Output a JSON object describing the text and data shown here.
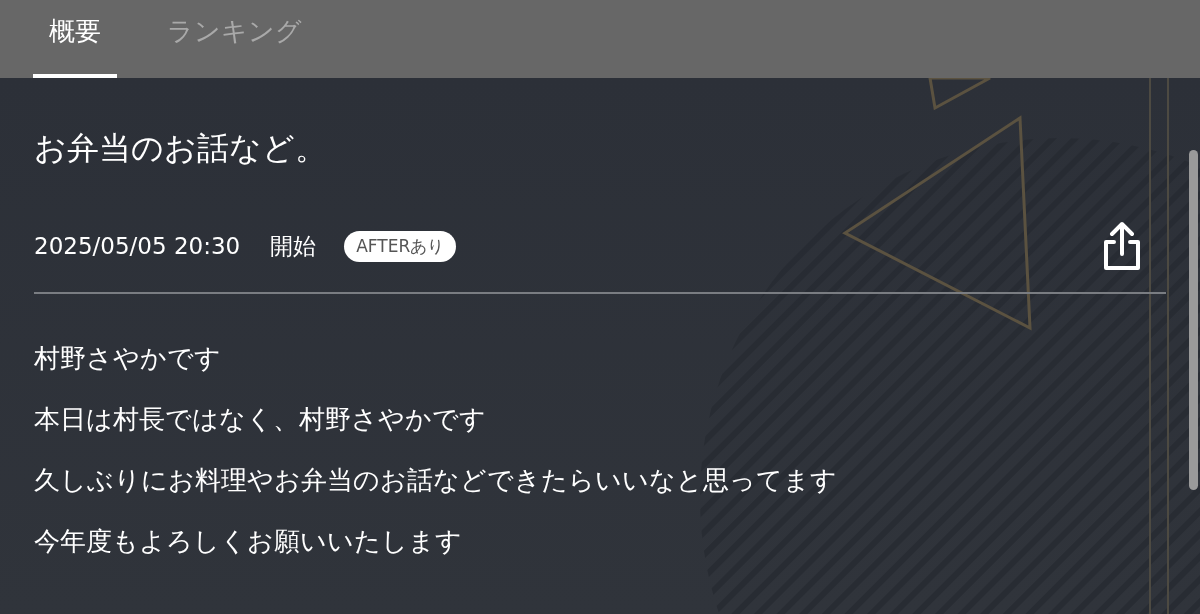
{
  "tabs": [
    {
      "label": "概要",
      "selected": true
    },
    {
      "label": "ランキング",
      "selected": false
    }
  ],
  "title": "お弁当のお話など。",
  "datetime": "2025/05/05 20:30",
  "status": "開始",
  "badge": "AFTERあり",
  "description": [
    "村野さやかです",
    "本日は村長ではなく、村野さやかです",
    "久しぶりにお料理やお弁当のお話などできたらいいなと思ってます",
    "今年度もよろしくお願いいたします"
  ]
}
